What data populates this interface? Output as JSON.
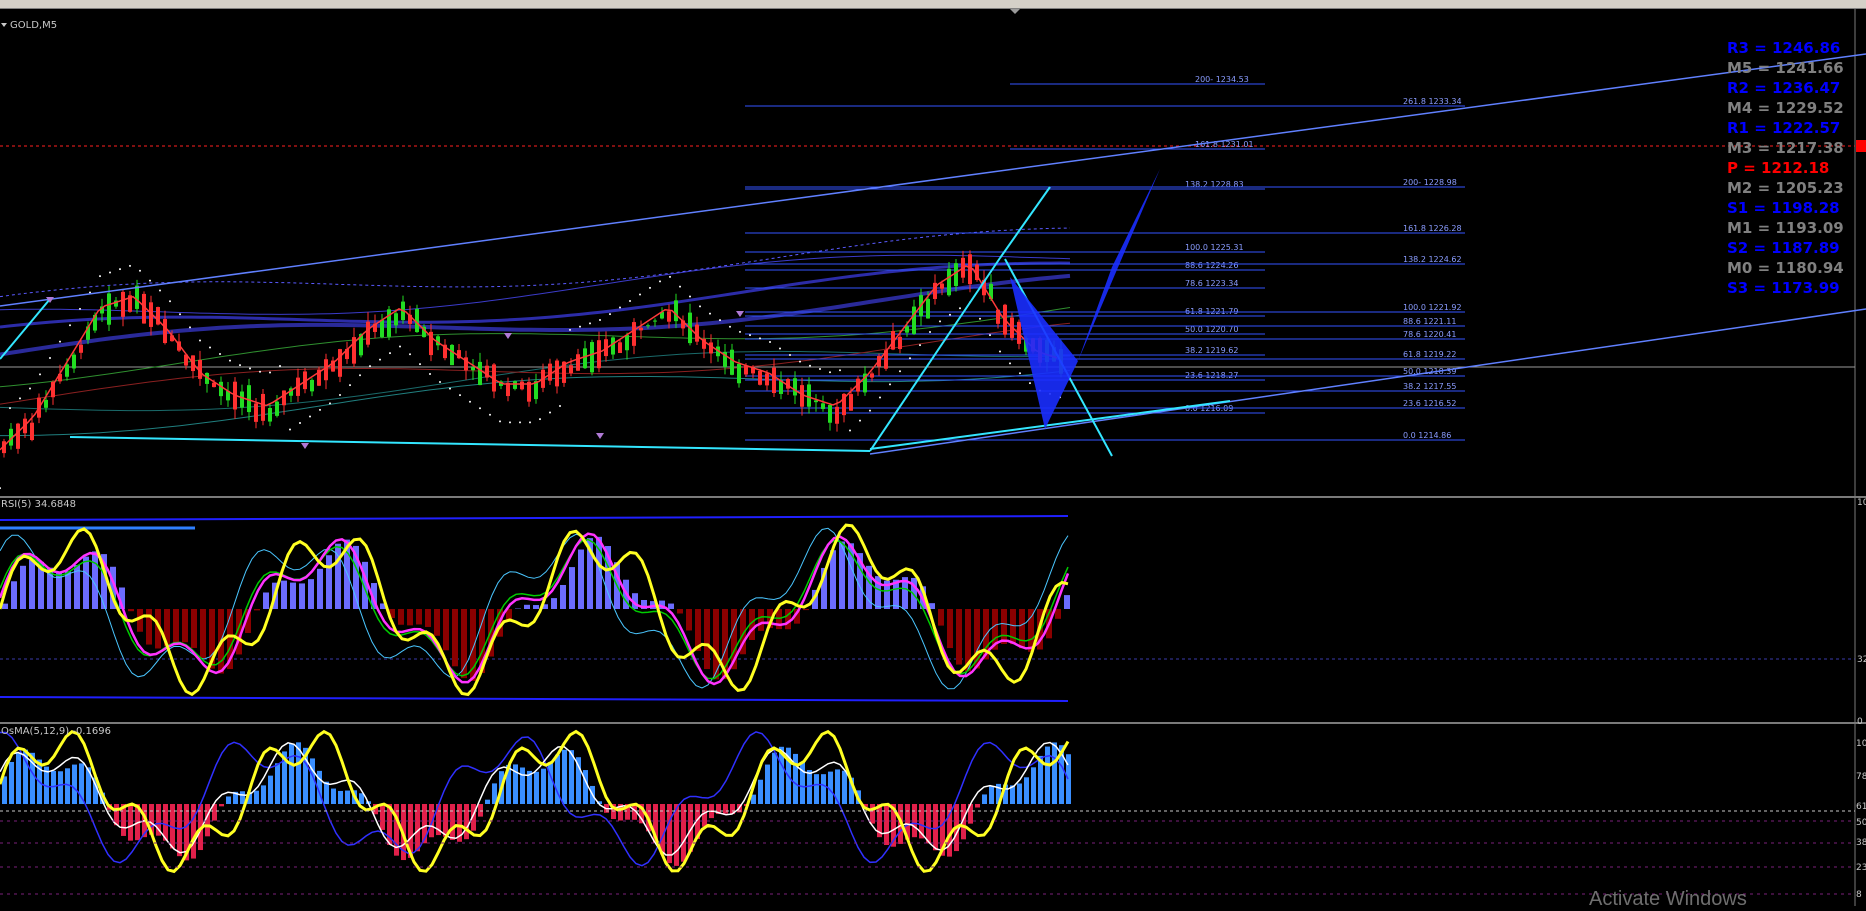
{
  "window": {
    "symbol_label": "GOLD,M5"
  },
  "main_panel": {
    "price_line_marker": "",
    "fib_left": [
      {
        "label": "200- 1234.53"
      },
      {
        "label": "161.8 1231.01"
      },
      {
        "label": "138.2  1228.83"
      },
      {
        "label": "100.0 1225.31"
      },
      {
        "label": "88.6 1224.26"
      },
      {
        "label": "78.6 1223.34"
      },
      {
        "label": "61.8 1221.79"
      },
      {
        "label": "50.0 1220.70"
      },
      {
        "label": "38.2 1219.62"
      },
      {
        "label": "23.6 1218.27"
      },
      {
        "label": "0.0 1216.09"
      }
    ],
    "fib_right": [
      {
        "label": "261.8 1233.34"
      },
      {
        "label": "200- 1228.98"
      },
      {
        "label": "161.8 1226.28"
      },
      {
        "label": "138.2  1224.62"
      },
      {
        "label": "100.0 1221.92"
      },
      {
        "label": "88.6 1221.11"
      },
      {
        "label": "78.6 1220.41"
      },
      {
        "label": "61.8 1219.22"
      },
      {
        "label": "50.0 1218.39"
      },
      {
        "label": "38.2 1217.55"
      },
      {
        "label": "23.6 1216.52"
      },
      {
        "label": "0.0 1214.86"
      }
    ],
    "pivots": [
      {
        "label": "R3 = 1246.86",
        "color": "#0000ff"
      },
      {
        "label": "M5 = 1241.66",
        "color": "#808080"
      },
      {
        "label": "R2 = 1236.47",
        "color": "#0000ff"
      },
      {
        "label": "M4 = 1229.52",
        "color": "#808080"
      },
      {
        "label": "R1 = 1222.57",
        "color": "#0000ff"
      },
      {
        "label": "M3 = 1217.38",
        "color": "#808080"
      },
      {
        "label": "P  = 1212.18",
        "color": "#ff0000"
      },
      {
        "label": "M2 = 1205.23",
        "color": "#808080"
      },
      {
        "label": "S1 = 1198.28",
        "color": "#0000ff"
      },
      {
        "label": "M1 = 1193.09",
        "color": "#808080"
      },
      {
        "label": "S2 = 1187.89",
        "color": "#0000ff"
      },
      {
        "label": "M0 = 1180.94",
        "color": "#808080"
      },
      {
        "label": "S3 = 1173.99",
        "color": "#0000ff"
      }
    ]
  },
  "rsi_panel": {
    "label": "RSI(5) 34.6848",
    "axis_labels": [
      "100",
      "32",
      "0"
    ]
  },
  "osma_panel": {
    "label": "OsMA(5,12,9) -0.1696",
    "axis_labels": [
      "100",
      "78",
      "61",
      "50",
      "38",
      "23",
      "8"
    ]
  },
  "colors": {
    "background": "#000000",
    "bull_candle": "#22dd22",
    "bear_candle": "#ff3030",
    "trend_line": "#6080ff",
    "cyan_line": "#33e6ff",
    "fib_line": "#3355ff",
    "fib_text": "#8a9cff",
    "harmonic_fill": "#1a2dff",
    "rsi_line": "#ffff22",
    "hist_up": "#6c6cff",
    "hist_down": "#8b0000",
    "osma_up": "#3a8fff",
    "osma_down": "#e0204a"
  },
  "watermark": "Activate Windows",
  "chart_data": [
    {
      "type": "line",
      "title": "GOLD,M5",
      "series": [
        {
          "values": [
            1206,
            1209,
            1214,
            1219,
            1220,
            1217,
            1213,
            1211,
            1210,
            1212,
            1214,
            1217,
            1219,
            1216,
            1214,
            1212,
            1212,
            1214,
            1215,
            1217,
            1219,
            1216,
            1214,
            1213,
            1211,
            1210,
            1213,
            1217,
            1221,
            1223,
            1218,
            1215,
            1214
          ]
        }
      ]
    },
    {
      "type": "bar",
      "title": "RSI(5) 34.6848",
      "ylim": [
        0,
        100
      ]
    },
    {
      "type": "bar",
      "title": "OsMA(5,12,9) -0.1696",
      "ylim": [
        0,
        100
      ]
    }
  ]
}
